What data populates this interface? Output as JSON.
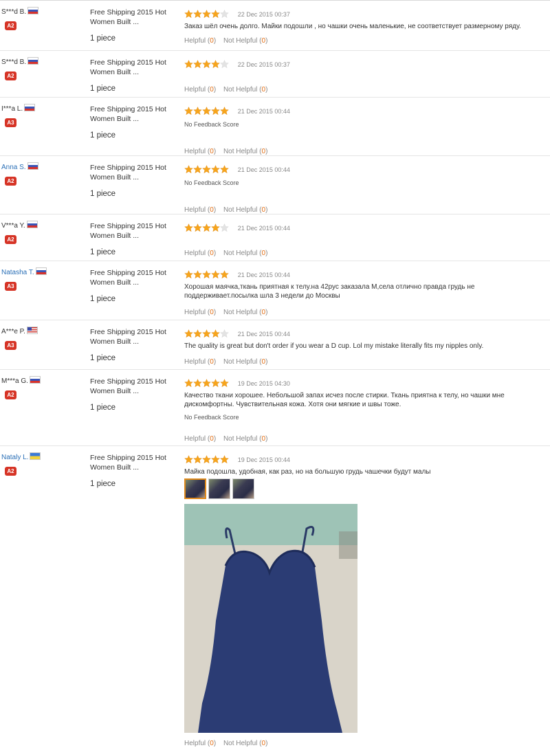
{
  "labels": {
    "helpful": "Helpful",
    "not_helpful": "Not Helpful",
    "no_feedback": "No Feedback Score"
  },
  "reviews": [
    {
      "user": "S***d B.",
      "country": "ru",
      "level": "A2",
      "product": "Free Shipping 2015 Hot Women Built ...",
      "qty": "1 piece",
      "rating": 4,
      "date": "22 Dec 2015 00:37",
      "text": "Заказ шёл очень долго. Майки подошли , но чашки очень маленькие, не соответствует размерному ряду.",
      "no_feedback": false,
      "helpful": "0",
      "not_helpful": "0"
    },
    {
      "user": "S***d B.",
      "country": "ru",
      "level": "A2",
      "product": "Free Shipping 2015 Hot Women Built ...",
      "qty": "1 piece",
      "rating": 4,
      "date": "22 Dec 2015 00:37",
      "text": "",
      "no_feedback": false,
      "helpful": "0",
      "not_helpful": "0"
    },
    {
      "user": "I***a L.",
      "country": "ru",
      "level": "A3",
      "product": "Free Shipping 2015 Hot Women Built ...",
      "qty": "1 piece",
      "rating": 5,
      "date": "21 Dec 2015 00:44",
      "text": "",
      "no_feedback": true,
      "helpful": "0",
      "not_helpful": "0"
    },
    {
      "user": "Anna S.",
      "country": "ru",
      "level": "A2",
      "product": "Free Shipping 2015 Hot Women Built ...",
      "qty": "1 piece",
      "rating": 5,
      "date": "21 Dec 2015 00:44",
      "text": "",
      "no_feedback": true,
      "helpful": "0",
      "not_helpful": "0",
      "link": true
    },
    {
      "user": "V***a Y.",
      "country": "ru",
      "level": "A2",
      "product": "Free Shipping 2015 Hot Women Built ...",
      "qty": "1 piece",
      "rating": 4,
      "date": "21 Dec 2015 00:44",
      "text": "",
      "no_feedback": false,
      "helpful": "0",
      "not_helpful": "0"
    },
    {
      "user": "Natasha T.",
      "country": "ru",
      "level": "A3",
      "product": "Free Shipping 2015 Hot Women Built ...",
      "qty": "1 piece",
      "rating": 5,
      "date": "21 Dec 2015 00:44",
      "text": "Хорошая маячка,ткань приятная к телу.на 42рус заказала М,села отлично правда грудь не поддерживает.посылка шла 3 недели до Москвы",
      "no_feedback": false,
      "helpful": "0",
      "not_helpful": "0",
      "link": true
    },
    {
      "user": "A***e P.",
      "country": "us",
      "level": "A3",
      "product": "Free Shipping 2015 Hot Women Built ...",
      "qty": "1 piece",
      "rating": 4,
      "date": "21 Dec 2015 00:44",
      "text": "The quality is great but don't order if you wear a D cup. Lol my mistake literally fits my nipples only.",
      "no_feedback": false,
      "helpful": "0",
      "not_helpful": "0"
    },
    {
      "user": "M***a G.",
      "country": "ru",
      "level": "A2",
      "product": "Free Shipping 2015 Hot Women Built ...",
      "qty": "1 piece",
      "rating": 5,
      "date": "19 Dec 2015 04:30",
      "text": "Качество ткани хорошее. Небольшой запах исчез после стирки. Ткань приятна к телу, но чашки мне дискомфортны. Чувствительная кожа. Хотя они мягкие и швы тоже.",
      "no_feedback": true,
      "helpful": "0",
      "not_helpful": "0"
    },
    {
      "user": "Nataly L.",
      "country": "ua",
      "level": "A2",
      "product": "Free Shipping 2015 Hot Women Built ...",
      "qty": "1 piece",
      "rating": 5,
      "date": "19 Dec 2015 00:44",
      "text": "Майка подошла, удобная, как раз, но на большую грудь чашечки будут малы",
      "no_feedback": false,
      "helpful": "0",
      "not_helpful": "0",
      "link": true,
      "photos": 3
    }
  ]
}
